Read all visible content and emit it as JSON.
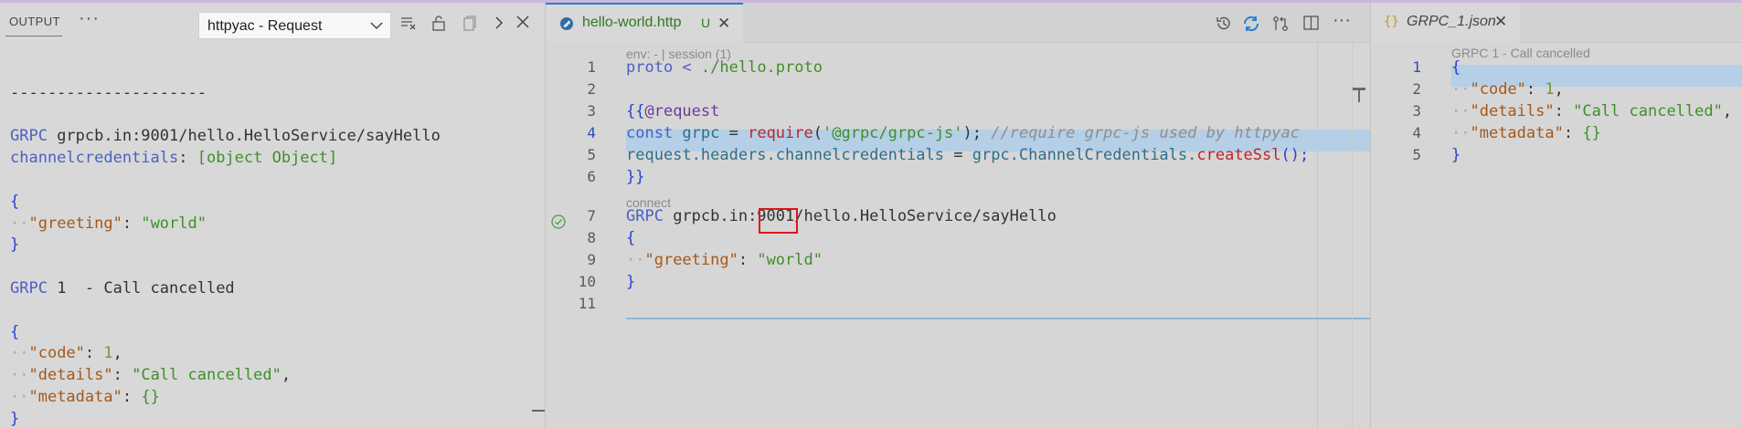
{
  "output_panel": {
    "tab_label": "OUTPUT",
    "channel_select": "httpyac - Request",
    "lines": [
      {
        "parts": [
          {
            "t": "",
            "c": "plain"
          }
        ]
      },
      {
        "parts": [
          {
            "t": "---------------------",
            "c": "plain"
          }
        ]
      },
      {
        "parts": [
          {
            "t": "",
            "c": "plain"
          }
        ]
      },
      {
        "parts": [
          {
            "t": "GRPC",
            "c": "kw"
          },
          {
            "t": " grpcb.in:9001/hello.HelloService/sayHello",
            "c": "plain"
          }
        ]
      },
      {
        "parts": [
          {
            "t": "channelcredentials",
            "c": "kw"
          },
          {
            "t": ": ",
            "c": "plain"
          },
          {
            "t": "[object Object]",
            "c": "str"
          }
        ]
      },
      {
        "parts": [
          {
            "t": "",
            "c": "plain"
          }
        ]
      },
      {
        "parts": [
          {
            "t": "{",
            "c": "brace"
          }
        ]
      },
      {
        "parts": [
          {
            "t": "··",
            "c": "dot"
          },
          {
            "t": "\"greeting\"",
            "c": "prop"
          },
          {
            "t": ": ",
            "c": "plain"
          },
          {
            "t": "\"world\"",
            "c": "str"
          }
        ]
      },
      {
        "parts": [
          {
            "t": "}",
            "c": "brace"
          }
        ]
      },
      {
        "parts": [
          {
            "t": "",
            "c": "plain"
          }
        ]
      },
      {
        "parts": [
          {
            "t": "GRPC",
            "c": "kw"
          },
          {
            "t": " 1",
            "c": "plain"
          },
          {
            "t": "  - Call cancelled",
            "c": "plain"
          }
        ]
      },
      {
        "parts": [
          {
            "t": "",
            "c": "plain"
          }
        ]
      },
      {
        "parts": [
          {
            "t": "{",
            "c": "brace"
          }
        ]
      },
      {
        "parts": [
          {
            "t": "··",
            "c": "dot"
          },
          {
            "t": "\"code\"",
            "c": "prop"
          },
          {
            "t": ": ",
            "c": "plain"
          },
          {
            "t": "1",
            "c": "num"
          },
          {
            "t": ",",
            "c": "plain"
          }
        ]
      },
      {
        "parts": [
          {
            "t": "··",
            "c": "dot"
          },
          {
            "t": "\"details\"",
            "c": "prop"
          },
          {
            "t": ": ",
            "c": "plain"
          },
          {
            "t": "\"Call cancelled\"",
            "c": "str"
          },
          {
            "t": ",",
            "c": "plain"
          }
        ]
      },
      {
        "parts": [
          {
            "t": "··",
            "c": "dot"
          },
          {
            "t": "\"metadata\"",
            "c": "prop"
          },
          {
            "t": ": ",
            "c": "plain"
          },
          {
            "t": "{}",
            "c": "str"
          }
        ]
      },
      {
        "parts": [
          {
            "t": "}",
            "c": "brace"
          }
        ]
      }
    ]
  },
  "editor": {
    "tab_label": "hello-world.http",
    "tab_badge": "U",
    "codelens_top": "env: - | session (1)",
    "codelens_connect": "connect",
    "lines": [
      {
        "num": "1",
        "parts": [
          {
            "t": "proto",
            "c": "kw"
          },
          {
            "t": " < ",
            "c": "kw"
          },
          {
            "t": "./hello.proto",
            "c": "str"
          }
        ]
      },
      {
        "num": "2",
        "parts": []
      },
      {
        "num": "3",
        "parts": [
          {
            "t": "{{",
            "c": "brace"
          },
          {
            "t": "@request",
            "c": "var"
          }
        ]
      },
      {
        "num": "4",
        "parts": [
          {
            "t": "const",
            "c": "kw"
          },
          {
            "t": " grpc ",
            "c": "ident"
          },
          {
            "t": "= ",
            "c": "plain"
          },
          {
            "t": "require",
            "c": "fn"
          },
          {
            "t": "(",
            "c": "plain"
          },
          {
            "t": "'@grpc/grpc-js'",
            "c": "str"
          },
          {
            "t": ");",
            "c": "plain"
          },
          {
            "t": " //require grpc-js used by httpyac",
            "c": "cmt"
          }
        ]
      },
      {
        "num": "5",
        "parts": [
          {
            "t": "request",
            "c": "ident"
          },
          {
            "t": ".headers.channelcredentials ",
            "c": "ident"
          },
          {
            "t": "= ",
            "c": "plain"
          },
          {
            "t": "grpc",
            "c": "ident"
          },
          {
            "t": ".ChannelCredentials.",
            "c": "ident"
          },
          {
            "t": "createSsl",
            "c": "fn"
          },
          {
            "t": "();",
            "c": "brace"
          }
        ]
      },
      {
        "num": "6",
        "parts": [
          {
            "t": "}}",
            "c": "brace"
          }
        ]
      },
      {
        "num": "7",
        "parts": [
          {
            "t": "GRPC",
            "c": "kw"
          },
          {
            "t": " grpcb.in:9001/hello.HelloService/sayHello",
            "c": "plain"
          }
        ]
      },
      {
        "num": "8",
        "parts": [
          {
            "t": "{",
            "c": "brace"
          }
        ]
      },
      {
        "num": "9",
        "parts": [
          {
            "t": "··",
            "c": "dot"
          },
          {
            "t": "\"greeting\"",
            "c": "prop"
          },
          {
            "t": ": ",
            "c": "plain"
          },
          {
            "t": "\"world\"",
            "c": "str"
          }
        ]
      },
      {
        "num": "10",
        "parts": [
          {
            "t": "}",
            "c": "brace"
          }
        ]
      },
      {
        "num": "11",
        "parts": []
      }
    ]
  },
  "response": {
    "tab_label": "GRPC_1.json",
    "tab_icon": "{}",
    "codelens": "GRPC 1 - Call cancelled",
    "lines": [
      {
        "num": "1",
        "parts": [
          {
            "t": "{",
            "c": "brace"
          }
        ]
      },
      {
        "num": "2",
        "parts": [
          {
            "t": "··",
            "c": "dot"
          },
          {
            "t": "\"code\"",
            "c": "prop"
          },
          {
            "t": ": ",
            "c": "plain"
          },
          {
            "t": "1",
            "c": "num"
          },
          {
            "t": ",",
            "c": "plain"
          }
        ]
      },
      {
        "num": "3",
        "parts": [
          {
            "t": "··",
            "c": "dot"
          },
          {
            "t": "\"details\"",
            "c": "prop"
          },
          {
            "t": ": ",
            "c": "plain"
          },
          {
            "t": "\"Call cancelled\"",
            "c": "str"
          },
          {
            "t": ",",
            "c": "plain"
          }
        ]
      },
      {
        "num": "4",
        "parts": [
          {
            "t": "··",
            "c": "dot"
          },
          {
            "t": "\"metadata\"",
            "c": "prop"
          },
          {
            "t": ": ",
            "c": "plain"
          },
          {
            "t": "{}",
            "c": "str"
          }
        ]
      },
      {
        "num": "5",
        "parts": [
          {
            "t": "}",
            "c": "brace"
          }
        ]
      }
    ]
  },
  "icons": {
    "output": [
      "more-actions-icon",
      "chevron-down-icon",
      "clear-output-icon",
      "lock-scroll-icon",
      "copy-icon",
      "maximize-panel-icon",
      "close-panel-icon"
    ],
    "editor": [
      "file-http-icon",
      "history-icon",
      "sync-icon",
      "compare-changes-icon",
      "split-editor-icon",
      "more-actions-icon",
      "check-circle-icon"
    ]
  },
  "colors": {
    "accent": "#2f7bd2",
    "highlight": "#b4cfe6",
    "annotation": "#e0141c",
    "modified": "#2f7a22"
  }
}
